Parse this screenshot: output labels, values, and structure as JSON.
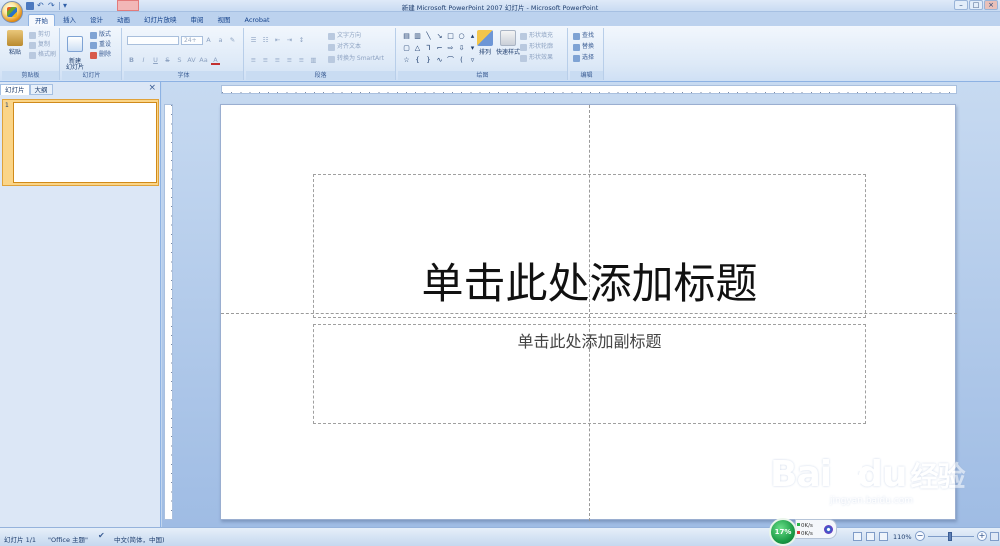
{
  "window": {
    "title": "新建 Microsoft PowerPoint 2007 幻灯片 - Microsoft PowerPoint",
    "controls": {
      "minimize": "–",
      "maximize": "□",
      "close": "×"
    }
  },
  "tabs": [
    {
      "label": "开始",
      "active": true
    },
    {
      "label": "插入",
      "active": false
    },
    {
      "label": "设计",
      "active": false
    },
    {
      "label": "动画",
      "active": false
    },
    {
      "label": "幻灯片放映",
      "active": false
    },
    {
      "label": "审阅",
      "active": false
    },
    {
      "label": "视图",
      "active": false
    },
    {
      "label": "Acrobat",
      "active": false
    }
  ],
  "ribbon": {
    "clipboard": {
      "label": "剪贴板",
      "paste": "粘贴",
      "cut": "剪切",
      "copy": "复制",
      "format_painter": "格式刷"
    },
    "slides": {
      "label": "幻灯片",
      "new_slide": "新建\n幻灯片",
      "layout": "版式",
      "reset": "重设",
      "delete": "删除"
    },
    "font": {
      "label": "字体",
      "font_size": "24+"
    },
    "paragraph": {
      "label": "段落",
      "text_direction": "文字方向",
      "align_text": "对齐文本",
      "convert_smartart": "转换为 SmartArt"
    },
    "drawing": {
      "label": "绘图",
      "arrange": "排列",
      "quick_styles": "快速样式",
      "shape_fill": "形状填充",
      "shape_outline": "形状轮廓",
      "shape_effects": "形状效果"
    },
    "editing": {
      "label": "编辑",
      "find": "查找",
      "replace": "替换",
      "select": "选择"
    }
  },
  "left_pane": {
    "tabs": [
      {
        "label": "幻灯片",
        "active": true
      },
      {
        "label": "大纲",
        "active": false
      }
    ],
    "close": "×",
    "thumb_number": "1"
  },
  "slide": {
    "title_placeholder": "单击此处添加标题",
    "subtitle_placeholder": "单击此处添加副标题"
  },
  "watermark": {
    "main": "Bai",
    "main2": "du",
    "cn": "经验",
    "sub": "jingyan.baidu.com"
  },
  "status": {
    "slide_count": "幻灯片 1/1",
    "theme": "\"Office 主题\"",
    "language": "中文(简体，中国)",
    "speed": "17%",
    "net_up": "0K/s",
    "net_down": "0K/s",
    "zoom": "110%"
  },
  "colors": {
    "ribbon_bg": "#dde9f7",
    "accent": "#15428b",
    "thumb_highlight": "#fbd588",
    "workspace_bg": "#a8c2e6"
  }
}
